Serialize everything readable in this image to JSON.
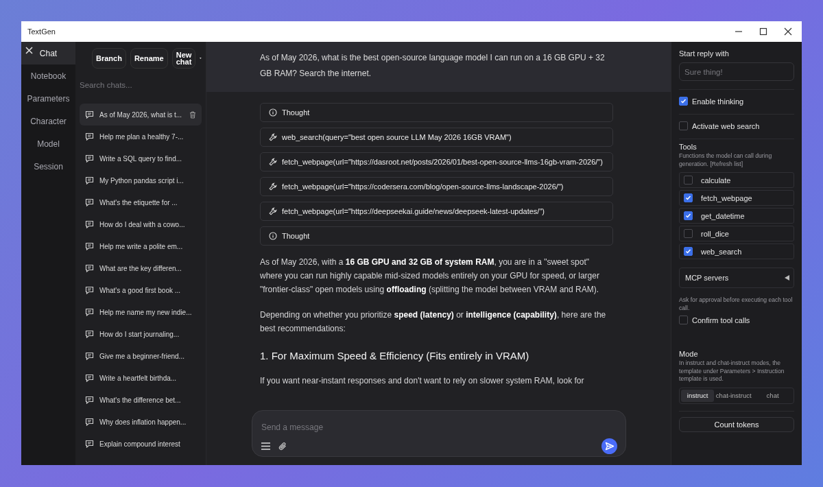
{
  "window": {
    "title": "TextGen"
  },
  "nav": [
    {
      "label": "Chat",
      "selected": true
    },
    {
      "label": "Notebook",
      "selected": false
    },
    {
      "label": "Parameters",
      "selected": false
    },
    {
      "label": "Character",
      "selected": false
    },
    {
      "label": "Model",
      "selected": false
    },
    {
      "label": "Session",
      "selected": false
    }
  ],
  "chat_actions": [
    "Branch",
    "Rename",
    "New chat"
  ],
  "search": {
    "placeholder": "Search chats..."
  },
  "chats": [
    {
      "title": "As of May 2026, what is t...",
      "selected": true
    },
    {
      "title": "Help me plan a healthy 7-...",
      "selected": false
    },
    {
      "title": "Write a SQL query to find...",
      "selected": false
    },
    {
      "title": "My Python pandas script i...",
      "selected": false
    },
    {
      "title": "What's the etiquette for ...",
      "selected": false
    },
    {
      "title": "How do I deal with a cowo...",
      "selected": false
    },
    {
      "title": "Help me write a polite em...",
      "selected": false
    },
    {
      "title": "What are the key differen...",
      "selected": false
    },
    {
      "title": "What's a good first book ...",
      "selected": false
    },
    {
      "title": "Help me name my new indie...",
      "selected": false
    },
    {
      "title": "How do I start journaling...",
      "selected": false
    },
    {
      "title": "Give me a beginner-friend...",
      "selected": false
    },
    {
      "title": "Write a heartfelt birthda...",
      "selected": false
    },
    {
      "title": "What's the difference bet...",
      "selected": false
    },
    {
      "title": "Why does inflation happen...",
      "selected": false
    },
    {
      "title": "Explain compound interest",
      "selected": false
    }
  ],
  "user_message": "As of May 2026, what is the best open-source language model I can run on a 16 GB GPU + 32 GB RAM? Search the internet.",
  "steps": [
    {
      "kind": "thought",
      "label": "Thought"
    },
    {
      "kind": "tool",
      "label": "web_search(query=\"best open source LLM May 2026 16GB VRAM\")"
    },
    {
      "kind": "tool",
      "label": "fetch_webpage(url=\"https://dasroot.net/posts/2026/01/best-open-source-llms-16gb-vram-2026/\")"
    },
    {
      "kind": "tool",
      "label": "fetch_webpage(url=\"https://codersera.com/blog/open-source-llms-landscape-2026/\")"
    },
    {
      "kind": "tool",
      "label": "fetch_webpage(url=\"https://deepseekai.guide/news/deepseek-latest-updates/\")"
    },
    {
      "kind": "thought",
      "label": "Thought"
    }
  ],
  "reply": [
    {
      "kind": "paragraph",
      "text": "As of May 2026, with a **16 GB GPU and 32 GB of system RAM**, you are in a \"sweet spot\" where you can run highly capable mid-sized models entirely on your GPU for speed, or larger \"frontier-class\" open models using **offloading** (splitting the model between VRAM and RAM)."
    },
    {
      "kind": "paragraph",
      "text": "Depending on whether you prioritize **speed (latency)** or **intelligence (capability)**, here are the best recommendations:"
    },
    {
      "kind": "heading",
      "text": "1. For Maximum Speed & Efficiency (Fits entirely in VRAM)"
    },
    {
      "kind": "paragraph",
      "text": "If you want near-instant responses and don't want to rely on slower system RAM, look for"
    }
  ],
  "composer": {
    "placeholder": "Send a message"
  },
  "settings": {
    "start_reply": {
      "label": "Start reply with",
      "placeholder": "Sure thing!"
    },
    "enable_thinking": {
      "label": "Enable thinking",
      "checked": true
    },
    "web_search": {
      "label": "Activate web search",
      "checked": false
    },
    "tools": {
      "title": "Tools",
      "description": "Functions the model can call during generation. [Refresh list]",
      "items": [
        {
          "name": "calculate",
          "checked": false
        },
        {
          "name": "fetch_webpage",
          "checked": true
        },
        {
          "name": "get_datetime",
          "checked": true
        },
        {
          "name": "roll_dice",
          "checked": false
        },
        {
          "name": "web_search",
          "checked": true
        }
      ]
    },
    "mcp_servers": {
      "label": "MCP servers",
      "expanded": false
    },
    "confirm": {
      "description": "Ask for approval before executing each tool call.",
      "label": "Confirm tool calls",
      "checked": false
    },
    "mode": {
      "title": "Mode",
      "description": "In instruct and chat-instruct modes, the template under Parameters > Instruction template is used.",
      "options": [
        {
          "label": "instruct",
          "selected": true
        },
        {
          "label": "chat-instruct",
          "selected": false
        },
        {
          "label": "chat",
          "selected": false
        }
      ]
    },
    "count_tokens": "Count tokens"
  }
}
